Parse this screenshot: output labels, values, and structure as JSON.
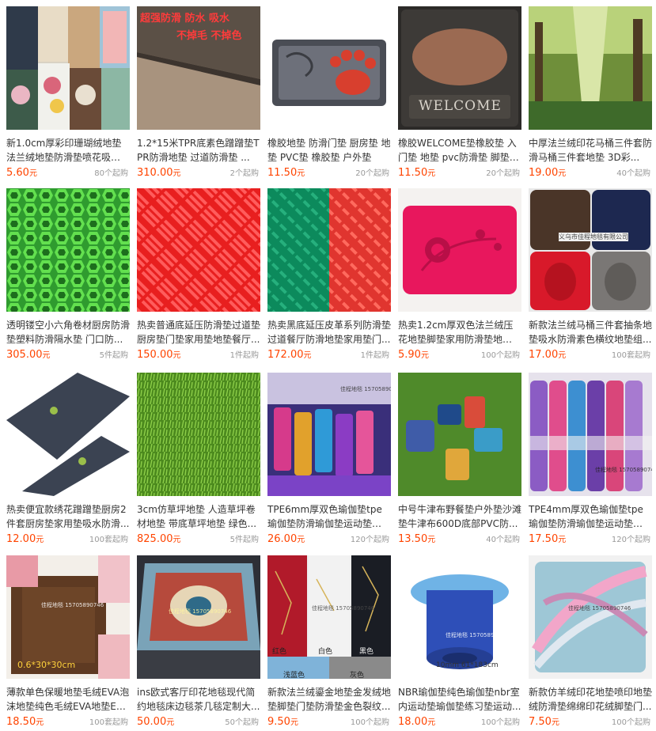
{
  "products": [
    {
      "title": "新1.0cm厚彩印珊瑚绒地垫法兰绒地垫防滑垫喷花吸水垫...",
      "price": "5.60",
      "unit": "元",
      "moq": "80个起购"
    },
    {
      "title": "1.2*15米TPR底素色蹭蹭垫TPR防滑地垫 过道防滑垫 ...",
      "price": "310.00",
      "unit": "元",
      "moq": "2个起购"
    },
    {
      "title": "橡胶地垫 防滑门垫 厨房垫 地垫 PVC垫 橡胶垫 户外垫",
      "price": "11.50",
      "unit": "元",
      "moq": "20个起购"
    },
    {
      "title": "橡胶WELCOME垫橡胶垫 入门垫 地垫 pvc防滑垫 脚垫 ...",
      "price": "11.50",
      "unit": "元",
      "moq": "20个起购"
    },
    {
      "title": "中厚法兰绒印花马桶三件套防滑马桶三件套地垫 3D彩...",
      "price": "19.00",
      "unit": "元",
      "moq": "40个起购"
    },
    {
      "title": "透明镂空小六角卷材厨房防滑垫塑料防滑隔水垫 门口防...",
      "price": "305.00",
      "unit": "元",
      "moq": "5件起购"
    },
    {
      "title": "热卖普通底延压防滑垫过道垫厨房垫门垫家用垫地垫餐厅...",
      "price": "150.00",
      "unit": "元",
      "moq": "1件起购"
    },
    {
      "title": "热卖黑底延压皮革系列防滑垫过道餐厅防滑地垫家用垫门...",
      "price": "172.00",
      "unit": "元",
      "moq": "1件起购"
    },
    {
      "title": "热卖1.2cm厚双色法兰绒压花地垫脚垫家用防滑垫地毯床...",
      "price": "5.90",
      "unit": "元",
      "moq": "100个起购"
    },
    {
      "title": "新款法兰绒马桶三件套抽条地垫吸水防滑素色横纹地垫组...",
      "price": "17.00",
      "unit": "元",
      "moq": "100套起购"
    },
    {
      "title": "热卖便宜款绣花蹭蹭垫厨房2件套厨房垫家用垫吸水防滑...",
      "price": "12.00",
      "unit": "元",
      "moq": "100套起购"
    },
    {
      "title": "3cm仿草坪地垫 人造草坪卷材地垫 带底草坪地垫 绿色...",
      "price": "825.00",
      "unit": "元",
      "moq": "5件起购"
    },
    {
      "title": "TPE6mm厚双色瑜伽垫tpe瑜伽垫防滑瑜伽垫运动垫练习...",
      "price": "26.00",
      "unit": "元",
      "moq": "120个起购"
    },
    {
      "title": "中号牛津布野餐垫户外垫沙滩垫牛津布600D底部PVC防...",
      "price": "13.50",
      "unit": "元",
      "moq": "40个起购"
    },
    {
      "title": "TPE4mm厚双色瑜伽垫tpe瑜伽垫防滑瑜伽垫运动垫练习...",
      "price": "17.50",
      "unit": "元",
      "moq": "120个起购"
    },
    {
      "title": "薄款单色保暖地垫毛绒EVA泡沫地垫纯色毛绒EVA地垫EV...",
      "price": "18.50",
      "unit": "元",
      "moq": "100套起购"
    },
    {
      "title": "ins欧式客厅印花地毯现代简约地毯床边毯茶几毯定制大...",
      "price": "50.00",
      "unit": "元",
      "moq": "50个起购"
    },
    {
      "title": "新款法兰绒鎏金地垫金发绒地垫脚垫门垫防滑垫金色裂纹...",
      "price": "9.50",
      "unit": "元",
      "moq": "100个起购"
    },
    {
      "title": "NBR瑜伽垫纯色瑜伽垫nbr室内运动垫瑜伽垫练习垫运动...",
      "price": "18.00",
      "unit": "元",
      "moq": "100个起购"
    },
    {
      "title": "新款仿羊绒印花地垫喷印地垫绒防滑垫绵绵印花绒脚垫门...",
      "price": "7.50",
      "unit": "元",
      "moq": "100个起购"
    }
  ],
  "image_text": {
    "p2_line1": "超强防滑  防水  吸水",
    "p2_line2": "不掉毛   不掉色",
    "p4_welcome": "WELCOME",
    "p10_store": "义乌市佳程地毯有限公司",
    "p13_watermark": "佳程地毯 15705890",
    "p15_watermark": "佳程地毯 15705890746",
    "p16_watermark": "佳程地毯 15705890746",
    "p16_size": "0.6*30*30cm",
    "p17_watermark": "佳程地毯 15705890746",
    "p18_watermark": "佳程地毯 15705890746",
    "p18_colors": [
      "红色",
      "白色",
      "黑色",
      "浅蓝色",
      "灰色"
    ],
    "p19_watermark": "佳程地毯 15705890746",
    "p19_size": "10mm 61*183cm",
    "p20_watermark": "佳程地毯 15705890746"
  },
  "colors": {
    "price": "#ff4400",
    "title": "#333333",
    "moq": "#999999"
  }
}
